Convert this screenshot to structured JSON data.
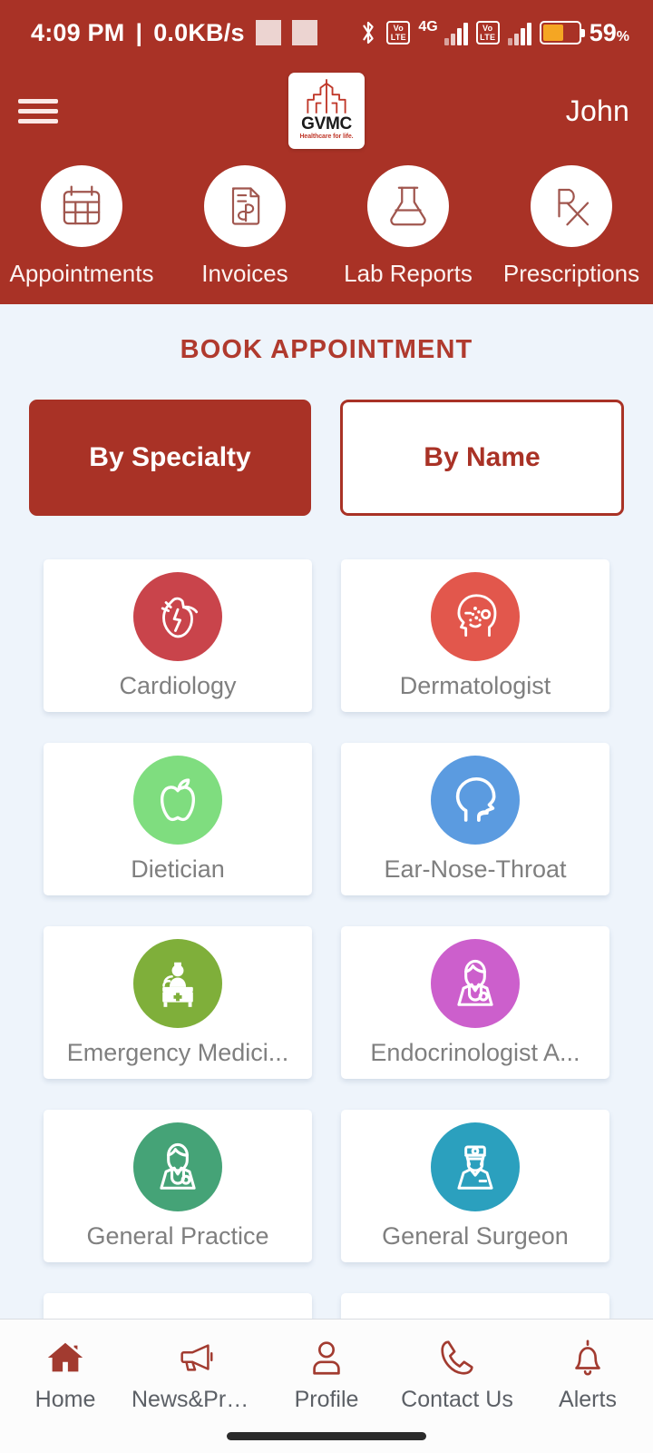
{
  "status_bar": {
    "time": "4:09 PM",
    "separator": "|",
    "network_speed": "0.0KB/s",
    "bluetooth_icon": "bluetooth-icon",
    "volte_line1": "Vo",
    "volte_line2": "LTE",
    "network_type": "4G",
    "battery_percent": "59",
    "battery_percent_symbol": "%",
    "battery_level": 59
  },
  "header": {
    "menu_icon": "hamburger-menu-icon",
    "logo_text": "GVMC",
    "logo_tagline": "Healthcare for life.",
    "user_name": "John"
  },
  "quick_actions": [
    {
      "label": "Appointments",
      "icon": "calendar-icon"
    },
    {
      "label": "Invoices",
      "icon": "invoice-dollar-icon"
    },
    {
      "label": "Lab Reports",
      "icon": "flask-icon"
    },
    {
      "label": "Prescriptions",
      "icon": "rx-prescription-icon"
    }
  ],
  "main": {
    "section_title": "BOOK APPOINTMENT",
    "tabs": [
      {
        "label": "By Specialty",
        "active": true
      },
      {
        "label": "By Name",
        "active": false
      }
    ],
    "specialties": [
      {
        "label": "Cardiology",
        "icon": "heart-anatomical-icon",
        "color": "#C9444B"
      },
      {
        "label": "Dermatologist",
        "icon": "skin-face-icon",
        "color": "#E2574C"
      },
      {
        "label": "Dietician",
        "icon": "apple-icon",
        "color": "#7FDD7F"
      },
      {
        "label": "Ear-Nose-Throat",
        "icon": "head-ent-icon",
        "color": "#5B9BE0"
      },
      {
        "label": "Emergency Medici...",
        "icon": "nurse-desk-icon",
        "color": "#7FAF3A"
      },
      {
        "label": "Endocrinologist A...",
        "icon": "doctor-icon",
        "color": "#CC5FCC"
      },
      {
        "label": "General Practice",
        "icon": "doctor-icon",
        "color": "#45A377"
      },
      {
        "label": "General Surgeon",
        "icon": "surgeon-icon",
        "color": "#2BA0BE"
      },
      {
        "label": "",
        "icon": "partial-icon",
        "color": "#2E6DA4"
      },
      {
        "label": "",
        "icon": "partial-icon",
        "color": "#1E8B44"
      }
    ]
  },
  "bottom_nav": [
    {
      "label": "Home",
      "icon": "home-icon"
    },
    {
      "label": "News&Prom...",
      "icon": "megaphone-icon"
    },
    {
      "label": "Profile",
      "icon": "person-icon"
    },
    {
      "label": "Contact Us",
      "icon": "phone-icon"
    },
    {
      "label": "Alerts",
      "icon": "bell-icon"
    }
  ],
  "theme": {
    "brand_red": "#A93226",
    "title_red": "#B03A2E",
    "page_bg": "#eef4fb",
    "card_bg": "#ffffff",
    "label_gray": "#7f7f7f"
  }
}
